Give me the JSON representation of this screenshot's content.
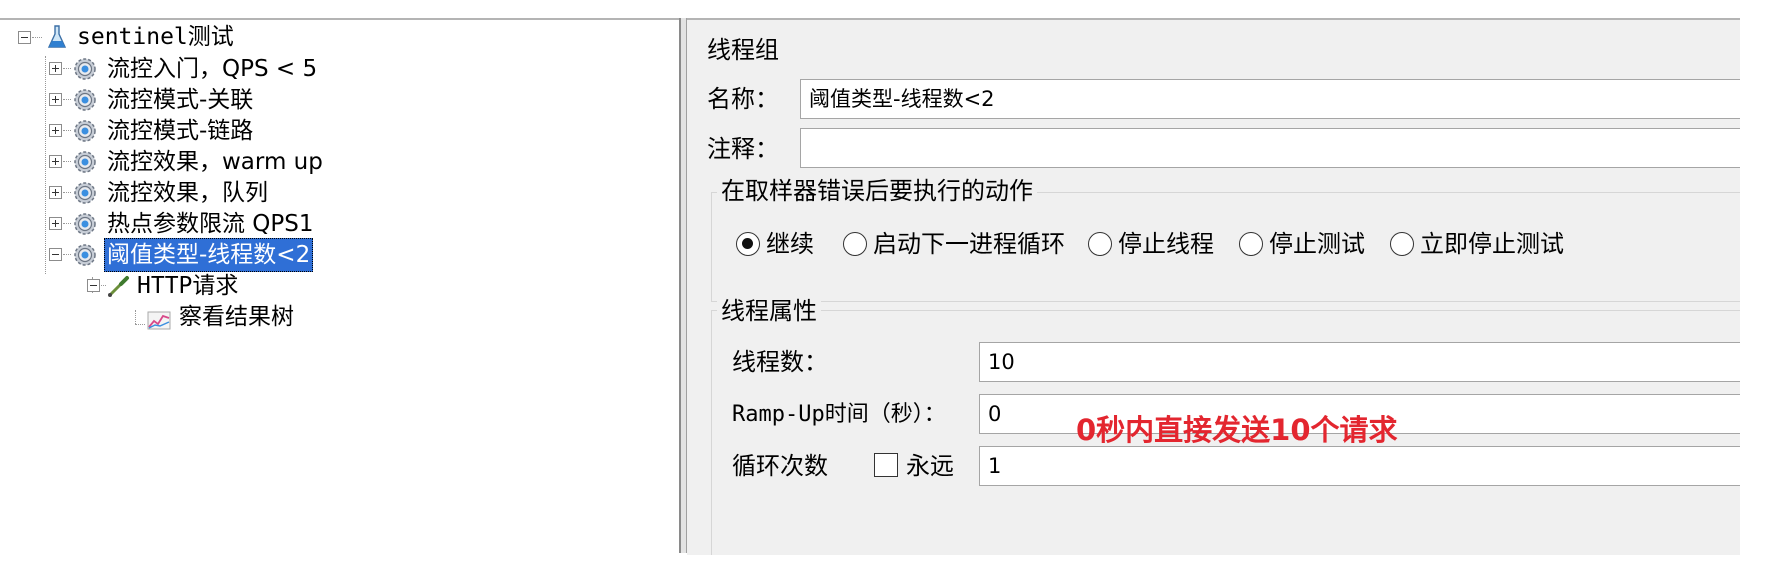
{
  "tree": {
    "root": "sentinel测试",
    "groups": [
      "流控入门，QPS < 5",
      "流控模式-关联",
      "流控模式-链路",
      "流控效果，warm up",
      "流控效果，队列",
      "热点参数限流 QPS1",
      "阈值类型-线程数<2"
    ],
    "sampler": "HTTP请求",
    "listener": "察看结果树"
  },
  "config": {
    "title": "线程组",
    "name_label": "名称：",
    "name_value": "阈值类型-线程数<2",
    "comment_label": "注释：",
    "comment_value": "",
    "error_action": {
      "title": "在取样器错误后要执行的动作",
      "options": [
        "继续",
        "启动下一进程循环",
        "停止线程",
        "停止测试",
        "立即停止测试"
      ],
      "selected": "继续"
    },
    "thread_props": {
      "title": "线程属性",
      "threads_label": "线程数：",
      "threads_value": "10",
      "rampup_label": "Ramp-Up时间（秒）：",
      "rampup_value": "0",
      "loop_label": "循环次数",
      "forever_label": "永远",
      "forever_checked": false,
      "loop_value": "1"
    },
    "annotation": "0秒内直接发送10个请求"
  },
  "colors": {
    "selection": "#2f6fd6",
    "annotation": "#e3262f",
    "panel_bg": "#f0f0f0"
  }
}
